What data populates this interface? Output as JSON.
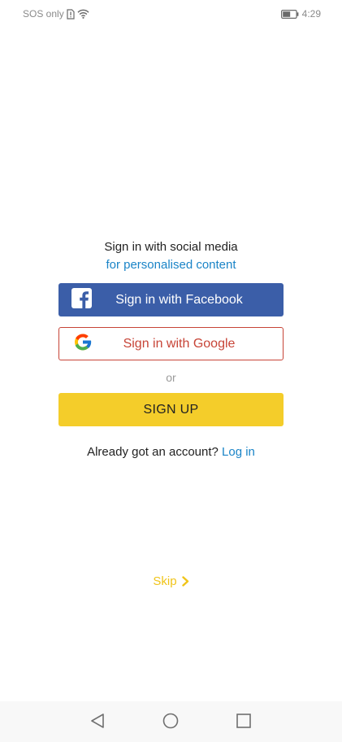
{
  "status_bar": {
    "carrier": "SOS only",
    "time": "4:29"
  },
  "signin": {
    "heading": "Sign in with social media",
    "subheading": "for personalised content",
    "facebook_label": "Sign in with Facebook",
    "google_label": "Sign in with Google",
    "or_label": "or",
    "signup_label": "SIGN UP",
    "account_prompt": "Already got an account?",
    "login_label": "Log in"
  },
  "skip": {
    "label": "Skip"
  },
  "colors": {
    "facebook": "#3b5ea8",
    "google": "#c74437",
    "signup": "#f4cd2a",
    "link": "#1a84c7",
    "skip": "#f0c419"
  },
  "icons": {
    "sim": "sim-alert-icon",
    "wifi": "wifi-icon",
    "battery": "battery-icon",
    "facebook": "facebook-logo-icon",
    "google": "google-logo-icon",
    "skip_arrow": "chevron-right-icon",
    "nav_back": "back-triangle-icon",
    "nav_home": "home-circle-icon",
    "nav_recent": "recents-square-icon"
  }
}
